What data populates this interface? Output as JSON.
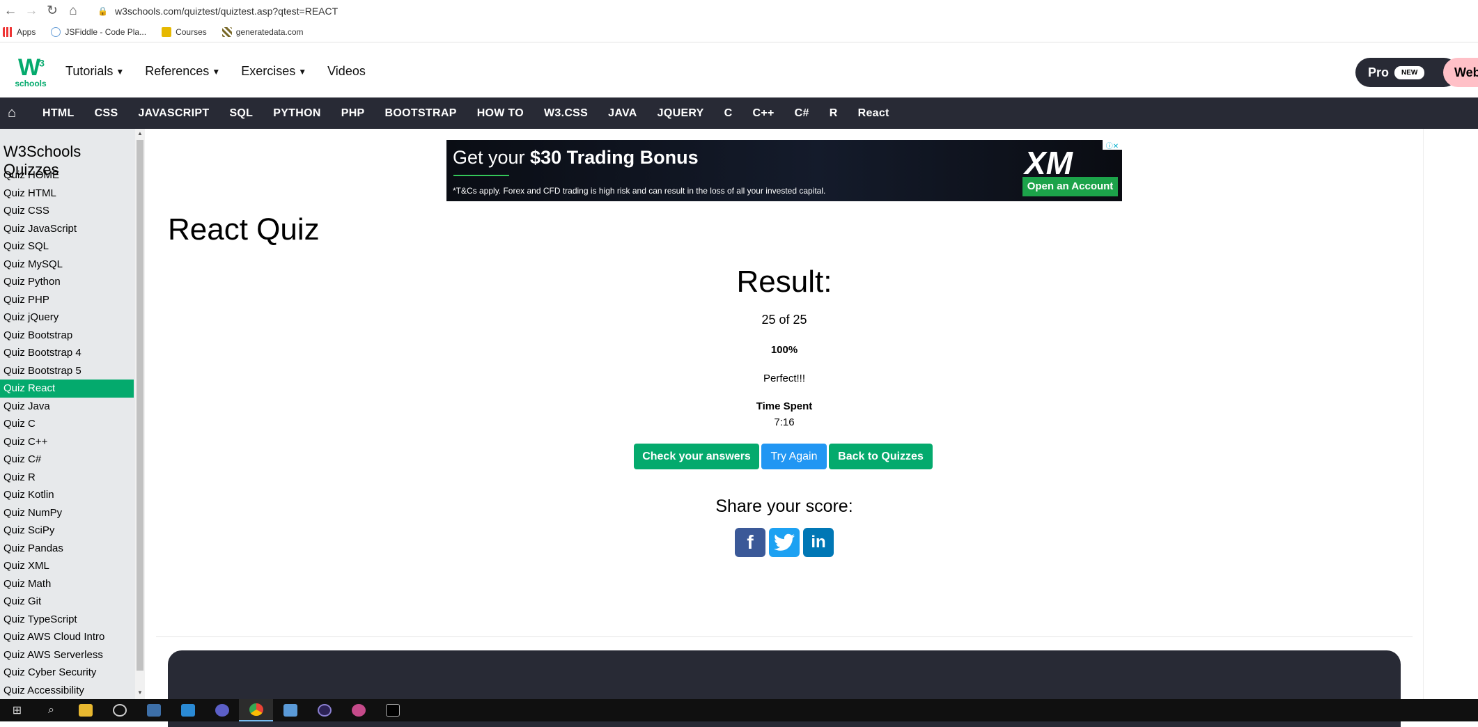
{
  "browser": {
    "url": "w3schools.com/quiztest/quiztest.asp?qtest=REACT",
    "bookmarks": [
      "Apps",
      "JSFiddle - Code Pla...",
      "Courses",
      "generatedata.com"
    ]
  },
  "header": {
    "logo_big": "W",
    "logo_sup": "3",
    "logo_small": "schools",
    "nav": [
      "Tutorials",
      "References",
      "Exercises",
      "Videos"
    ],
    "pro_label": "Pro",
    "pro_badge": "NEW",
    "web_label": "Web"
  },
  "subnav": [
    "HTML",
    "CSS",
    "JAVASCRIPT",
    "SQL",
    "PYTHON",
    "PHP",
    "BOOTSTRAP",
    "HOW TO",
    "W3.CSS",
    "JAVA",
    "JQUERY",
    "C",
    "C++",
    "C#",
    "R",
    "React"
  ],
  "sidebar": {
    "title": "W3Schools Quizzes",
    "active_item": "Quiz React",
    "items": [
      "Quiz HOME",
      "Quiz HTML",
      "Quiz CSS",
      "Quiz JavaScript",
      "Quiz SQL",
      "Quiz MySQL",
      "Quiz Python",
      "Quiz PHP",
      "Quiz jQuery",
      "Quiz Bootstrap",
      "Quiz Bootstrap 4",
      "Quiz Bootstrap 5",
      "Quiz React",
      "Quiz Java",
      "Quiz C",
      "Quiz C++",
      "Quiz C#",
      "Quiz R",
      "Quiz Kotlin",
      "Quiz NumPy",
      "Quiz SciPy",
      "Quiz Pandas",
      "Quiz XML",
      "Quiz Math",
      "Quiz Git",
      "Quiz TypeScript",
      "Quiz AWS Cloud Intro",
      "Quiz AWS Serverless",
      "Quiz Cyber Security",
      "Quiz Accessibility"
    ]
  },
  "ad": {
    "headline_pre": "Get your ",
    "headline_bold": "$30 Trading Bonus",
    "disclaimer": "*T&Cs apply. Forex and CFD trading is high risk and can result in the loss of all your invested capital.",
    "brand": "XM",
    "cta": "Open an Account"
  },
  "main": {
    "page_title": "React Quiz",
    "result_title": "Result:",
    "score": "25 of 25",
    "percent": "100%",
    "message": "Perfect!!!",
    "time_label": "Time Spent",
    "time_value": "7:16",
    "buttons": {
      "check": "Check your answers",
      "retry": "Try Again",
      "back": "Back to Quizzes"
    },
    "share_title": "Share your score:"
  },
  "colors": {
    "accent_green": "#04AA6D",
    "nav_dark": "#282A35",
    "try_blue": "#2196F3"
  }
}
